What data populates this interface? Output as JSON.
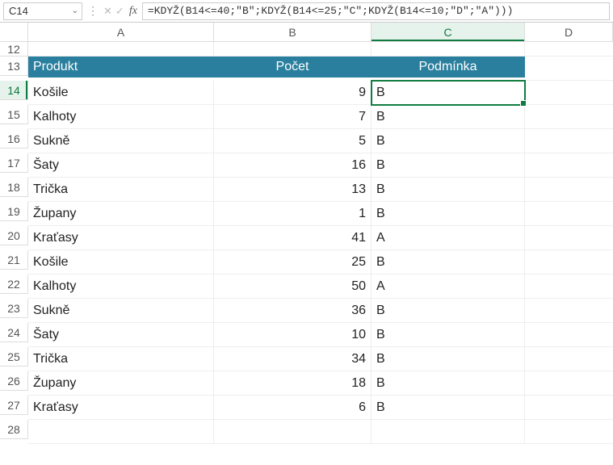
{
  "name_box": "C14",
  "formula": "=KDYŽ(B14<=40;\"B\";KDYŽ(B14<=25;\"C\";KDYŽ(B14<=10;\"D\";\"A\")))",
  "columns": [
    "A",
    "B",
    "C",
    "D"
  ],
  "active_col_index": 2,
  "active_row": 14,
  "row_start": 12,
  "row_end": 28,
  "headers": {
    "A": "Produkt",
    "B": "Počet",
    "C": "Podmínka"
  },
  "chart_data": {
    "type": "table",
    "title": "Produkt / Počet / Podmínka",
    "columns": [
      "Produkt",
      "Počet",
      "Podmínka"
    ],
    "rows": [
      [
        "Košile",
        9,
        "B"
      ],
      [
        "Kalhoty",
        7,
        "B"
      ],
      [
        "Sukně",
        5,
        "B"
      ],
      [
        "Šaty",
        16,
        "B"
      ],
      [
        "Trička",
        13,
        "B"
      ],
      [
        "Župany",
        1,
        "B"
      ],
      [
        "Kraťasy",
        41,
        "A"
      ],
      [
        "Košile",
        25,
        "B"
      ],
      [
        "Kalhoty",
        50,
        "A"
      ],
      [
        "Sukně",
        36,
        "B"
      ],
      [
        "Šaty",
        10,
        "B"
      ],
      [
        "Trička",
        34,
        "B"
      ],
      [
        "Župany",
        18,
        "B"
      ],
      [
        "Kraťasy",
        6,
        "B"
      ]
    ]
  }
}
